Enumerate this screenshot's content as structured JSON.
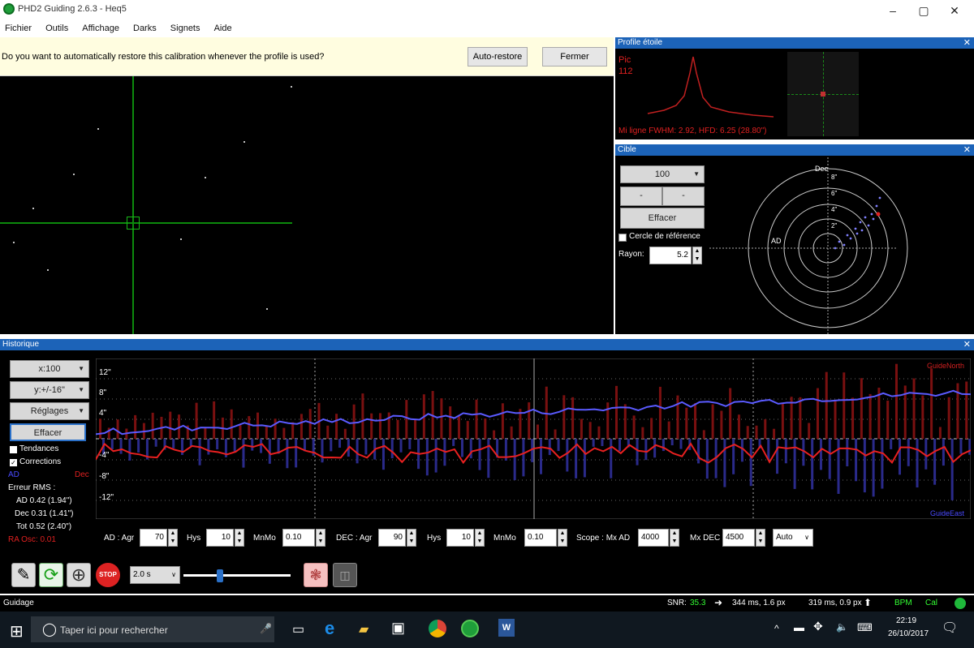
{
  "window": {
    "title": "PHD2 Guiding 2.6.3 - Heq5",
    "minimize": "–",
    "maximize": "▢",
    "close": "✕"
  },
  "menu": [
    "Fichier",
    "Outils",
    "Affichage",
    "Darks",
    "Signets",
    "Aide"
  ],
  "infobar": {
    "message": "Do you want to automatically restore this calibration whenever the profile is used?",
    "auto_restore": "Auto-restore",
    "fermer": "Fermer"
  },
  "profile": {
    "title": "Profile étoile",
    "pic_label": "Pic",
    "pic_value": "112",
    "stats": "Mi ligne FWHM: 2.92, HFD: 6.25 (28.80\")"
  },
  "target": {
    "title": "Cible",
    "zoom": "100",
    "minus": "-",
    "plus": "-",
    "clear": "Effacer",
    "ref_circle": "Cercle de référence",
    "radius_label": "Rayon:",
    "radius_value": "5.2",
    "dec_label": "Dec",
    "ad_label": "AD",
    "ring_labels": [
      "8\"",
      "6\"",
      "4\"",
      "2\""
    ]
  },
  "history": {
    "title": "Historique",
    "x_scale": "x:100",
    "y_scale": "y:+/-16\"",
    "settings": "Réglages",
    "clear": "Effacer",
    "trends": "Tendances",
    "corrections": "Corrections",
    "ad": "AD",
    "dec": "Dec",
    "rms_title": "Erreur RMS :",
    "rms_ad": "AD 0.42 (1.94\")",
    "rms_dec": "Dec 0.31 (1.41\")",
    "rms_tot": "Tot 0.52 (2.40\")",
    "ra_osc": "RA Osc: 0.01",
    "y_labels": [
      "12\"",
      "8\"",
      "4\"",
      "-4\"",
      "-8\"",
      "-12\""
    ],
    "guide_north": "GuideNorth",
    "guide_east": "GuideEast",
    "controls": {
      "ad_aggr_label": "AD : Agr",
      "ad_aggr": "70",
      "ad_hys_label": "Hys",
      "ad_hys": "10",
      "ad_mnmo_label": "MnMo",
      "ad_mnmo": "0.10",
      "dec_aggr_label": "DEC : Agr",
      "dec_aggr": "90",
      "dec_hys_label": "Hys",
      "dec_hys": "10",
      "dec_mnmo_label": "MnMo",
      "dec_mnmo": "0.10",
      "scope_label": "Scope : Mx AD",
      "mx_ad": "4000",
      "mx_dec_label": "Mx DEC",
      "mx_dec": "4500",
      "mode": "Auto"
    }
  },
  "toolbar": {
    "exposure": "2.0 s",
    "slider_value": 0.33
  },
  "status": {
    "mode": "Guidage",
    "snr_label": "SNR:",
    "snr_value": "35.3",
    "ra_info": "344 ms, 1.6 px",
    "dec_info": "319 ms, 0.9 px",
    "bpm": "BPM",
    "cal": "Cal"
  },
  "taskbar": {
    "search_placeholder": "Taper ici pour rechercher",
    "time": "22:19",
    "date": "26/10/2017"
  },
  "colors": {
    "ra": "#e02020",
    "dec": "#4a4aff",
    "accent": "#1c63b8"
  }
}
